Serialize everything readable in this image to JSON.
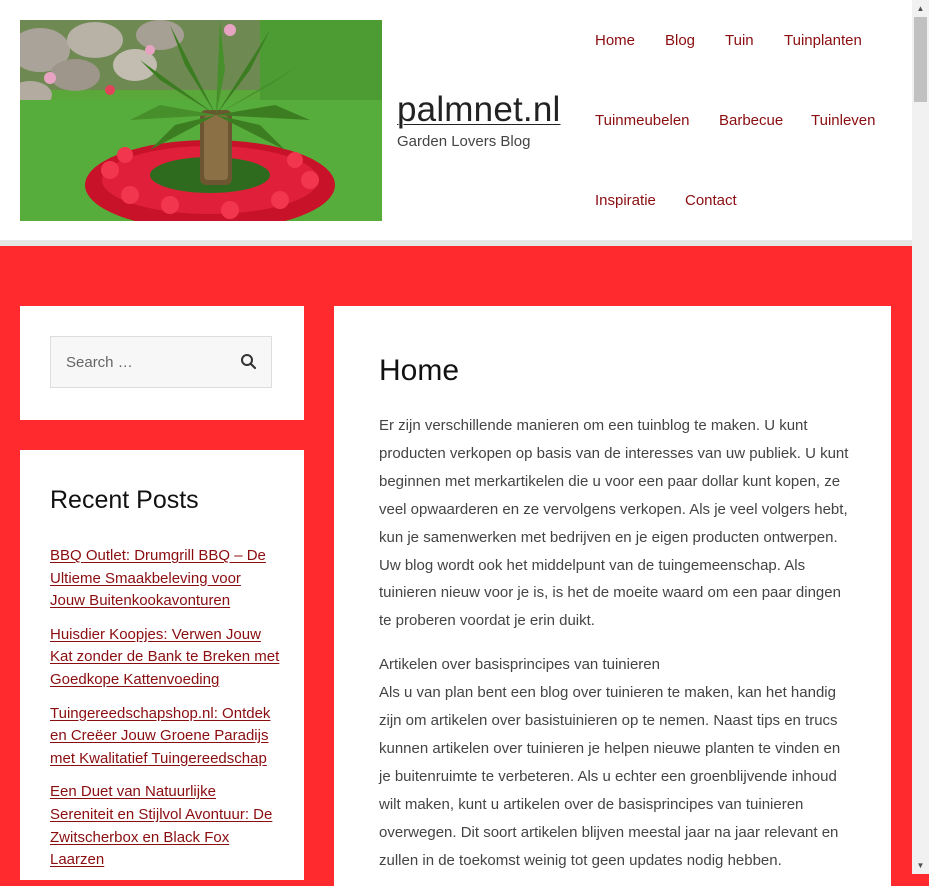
{
  "site": {
    "title": "palmnet.nl",
    "description": "Garden Lovers Blog",
    "logo_icon": "palm-garden-image"
  },
  "nav": {
    "items": [
      {
        "label": "Home"
      },
      {
        "label": "Blog"
      },
      {
        "label": "Tuin"
      },
      {
        "label": "Tuinplanten"
      },
      {
        "label": "Tuinmeubelen"
      },
      {
        "label": "Barbecue"
      },
      {
        "label": "Tuinleven"
      },
      {
        "label": "Inspiratie"
      },
      {
        "label": "Contact"
      }
    ]
  },
  "search": {
    "placeholder": "Search …",
    "icon": "search-icon"
  },
  "recent_posts": {
    "title": "Recent Posts",
    "items": [
      {
        "label": "BBQ Outlet: Drumgrill BBQ – De Ultieme Smaakbeleving voor Jouw Buitenkookavonturen"
      },
      {
        "label": "Huisdier Koopjes: Verwen Jouw Kat zonder de Bank te Breken met Goedkope Kattenvoeding"
      },
      {
        "label": "Tuingereedschapshop.nl: Ontdek en Creëer Jouw Groene Paradijs met Kwalitatief Tuingereedschap"
      },
      {
        "label": "Een Duet van Natuurlijke Sereniteit en Stijlvol Avontuur: De Zwitscherbox en Black Fox Laarzen"
      }
    ]
  },
  "main": {
    "title": "Home",
    "paragraph1": "Er zijn verschillende manieren om een tuinblog te maken. U kunt producten verkopen op basis van de interesses van uw publiek. U kunt beginnen met merkartikelen die u voor een paar dollar kunt kopen, ze veel opwaarderen en ze vervolgens verkopen. Als je veel volgers hebt, kun je samenwerken met bedrijven en je eigen producten ontwerpen. Uw blog wordt ook het middelpunt van de tuingemeenschap. Als tuinieren nieuw voor je is, is het de moeite waard om een paar dingen te proberen voordat je erin duikt.",
    "subheading": "Artikelen over basisprincipes van tuinieren",
    "paragraph2": "Als u van plan bent een blog over tuinieren te maken, kan het handig zijn om artikelen over basistuinieren op te nemen. Naast tips en trucs kunnen artikelen over tuinieren je helpen nieuwe planten te vinden en je buitenruimte te verbeteren. Als u echter een groenblijvende inhoud wilt maken, kunt u artikelen over de basisprincipes van tuinieren overwegen. Dit soort artikelen blijven meestal jaar na jaar relevant en zullen in de toekomst weinig tot geen updates nodig hebben."
  },
  "colors": {
    "accent": "#ff2a2e",
    "link": "#8a0d10"
  }
}
